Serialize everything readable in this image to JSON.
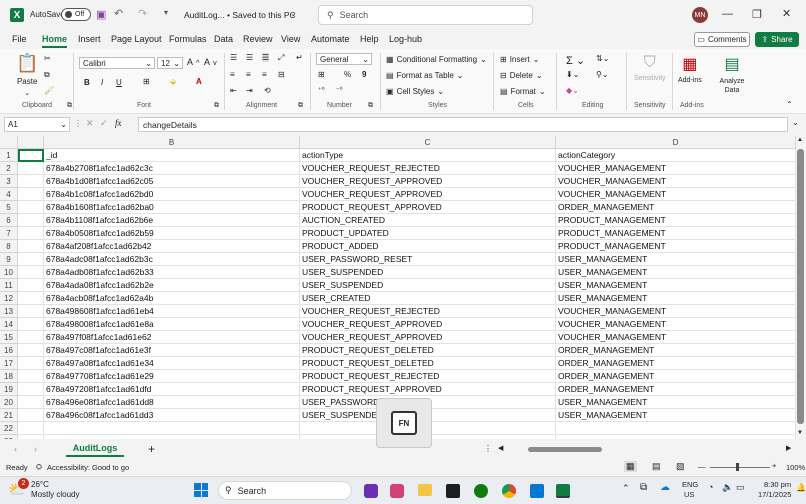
{
  "titlebar": {
    "autosave_label": "AutoSave",
    "autosave_state": "Off",
    "doc_title": "AuditLog... • Saved to this PC",
    "search_placeholder": "Search",
    "user_initials": "MN"
  },
  "menu": {
    "items": [
      "File",
      "Home",
      "Insert",
      "Page Layout",
      "Formulas",
      "Data",
      "Review",
      "View",
      "Automate",
      "Help",
      "Log-hub"
    ],
    "active": "Home",
    "comments_label": "Comments",
    "share_label": "Share"
  },
  "ribbon": {
    "paste_label": "Paste",
    "font_name": "Calibri",
    "font_size": "12",
    "number_format": "General",
    "conditional_formatting": "Conditional Formatting",
    "format_as_table": "Format as Table",
    "cell_styles": "Cell Styles",
    "insert": "Insert",
    "delete": "Delete",
    "format": "Format",
    "sensitivity": "Sensitivity",
    "addins": "Add-ins",
    "analyze_data": "Analyze Data",
    "groups": {
      "clipboard": "Clipboard",
      "font": "Font",
      "alignment": "Alignment",
      "number": "Number",
      "styles": "Styles",
      "cells": "Cells",
      "editing": "Editing",
      "sensitivity": "Sensitivity",
      "addins": "Add-ins"
    }
  },
  "formula_bar": {
    "name_box": "A1",
    "fx": "fx",
    "content": "changeDetails"
  },
  "sheet": {
    "columns": [
      "B",
      "C",
      "D"
    ],
    "rows": [
      [
        "_id",
        "actionType",
        "actionCategory"
      ],
      [
        "678a4b2708f1afcc1ad62c3c",
        "VOUCHER_REQUEST_REJECTED",
        "VOUCHER_MANAGEMENT"
      ],
      [
        "678a4b1d08f1afcc1ad62c05",
        "VOUCHER_REQUEST_APPROVED",
        "VOUCHER_MANAGEMENT"
      ],
      [
        "678a4b1c08f1afcc1ad62bd0",
        "VOUCHER_REQUEST_APPROVED",
        "VOUCHER_MANAGEMENT"
      ],
      [
        "678a4b1608f1afcc1ad62ba0",
        "PRODUCT_REQUEST_APPROVED",
        "ORDER_MANAGEMENT"
      ],
      [
        "678a4b1108f1afcc1ad62b6e",
        "AUCTION_CREATED",
        "PRODUCT_MANAGEMENT"
      ],
      [
        "678a4b0508f1afcc1ad62b59",
        "PRODUCT_UPDATED",
        "PRODUCT_MANAGEMENT"
      ],
      [
        "678a4af208f1afcc1ad62b42",
        "PRODUCT_ADDED",
        "PRODUCT_MANAGEMENT"
      ],
      [
        "678a4adc08f1afcc1ad62b3c",
        "USER_PASSWORD_RESET",
        "USER_MANAGEMENT"
      ],
      [
        "678a4adb08f1afcc1ad62b33",
        "USER_SUSPENDED",
        "USER_MANAGEMENT"
      ],
      [
        "678a4ada08f1afcc1ad62b2e",
        "USER_SUSPENDED",
        "USER_MANAGEMENT"
      ],
      [
        "678a4acb08f1afcc1ad62a4b",
        "USER_CREATED",
        "USER_MANAGEMENT"
      ],
      [
        "678a498608f1afcc1ad61eb4",
        "VOUCHER_REQUEST_REJECTED",
        "VOUCHER_MANAGEMENT"
      ],
      [
        "678a498008f1afcc1ad61e8a",
        "VOUCHER_REQUEST_APPROVED",
        "VOUCHER_MANAGEMENT"
      ],
      [
        "678a497f08f1afcc1ad61e62",
        "VOUCHER_REQUEST_APPROVED",
        "VOUCHER_MANAGEMENT"
      ],
      [
        "678a497c08f1afcc1ad61e3f",
        "PRODUCT_REQUEST_DELETED",
        "ORDER_MANAGEMENT"
      ],
      [
        "678a497a08f1afcc1ad61e34",
        "PRODUCT_REQUEST_DELETED",
        "ORDER_MANAGEMENT"
      ],
      [
        "678a497708f1afcc1ad61e29",
        "PRODUCT_REQUEST_REJECTED",
        "ORDER_MANAGEMENT"
      ],
      [
        "678a497208f1afcc1ad61dfd",
        "PRODUCT_REQUEST_APPROVED",
        "ORDER_MANAGEMENT"
      ],
      [
        "678a496e08f1afcc1ad61dd8",
        "USER_PASSWORD_RESET",
        "USER_MANAGEMENT"
      ],
      [
        "678a496c08f1afcc1ad61dd3",
        "USER_SUSPENDED",
        "USER_MANAGEMENT"
      ],
      [
        "",
        "",
        ""
      ],
      [
        "",
        "",
        ""
      ]
    ],
    "row_numbers": [
      "1",
      "2",
      "3",
      "4",
      "5",
      "6",
      "7",
      "8",
      "9",
      "10",
      "11",
      "12",
      "13",
      "14",
      "15",
      "16",
      "17",
      "18",
      "19",
      "20",
      "21",
      "22",
      "23"
    ]
  },
  "tabs": {
    "sheet_name": "AuditLogs"
  },
  "status": {
    "ready": "Ready",
    "accessibility": "Accessibility: Good to go",
    "zoom": "100%"
  },
  "popup": {
    "key_label": "FN"
  },
  "taskbar": {
    "temp": "26°C",
    "weather": "Mostly cloudy",
    "search": "Search",
    "lang1": "ENG",
    "lang2": "US",
    "time": "8:30 pm",
    "date": "17/1/2025",
    "notif_count": "2"
  },
  "colors": {
    "accent": "#107c41",
    "share_bg": "#107c41"
  }
}
